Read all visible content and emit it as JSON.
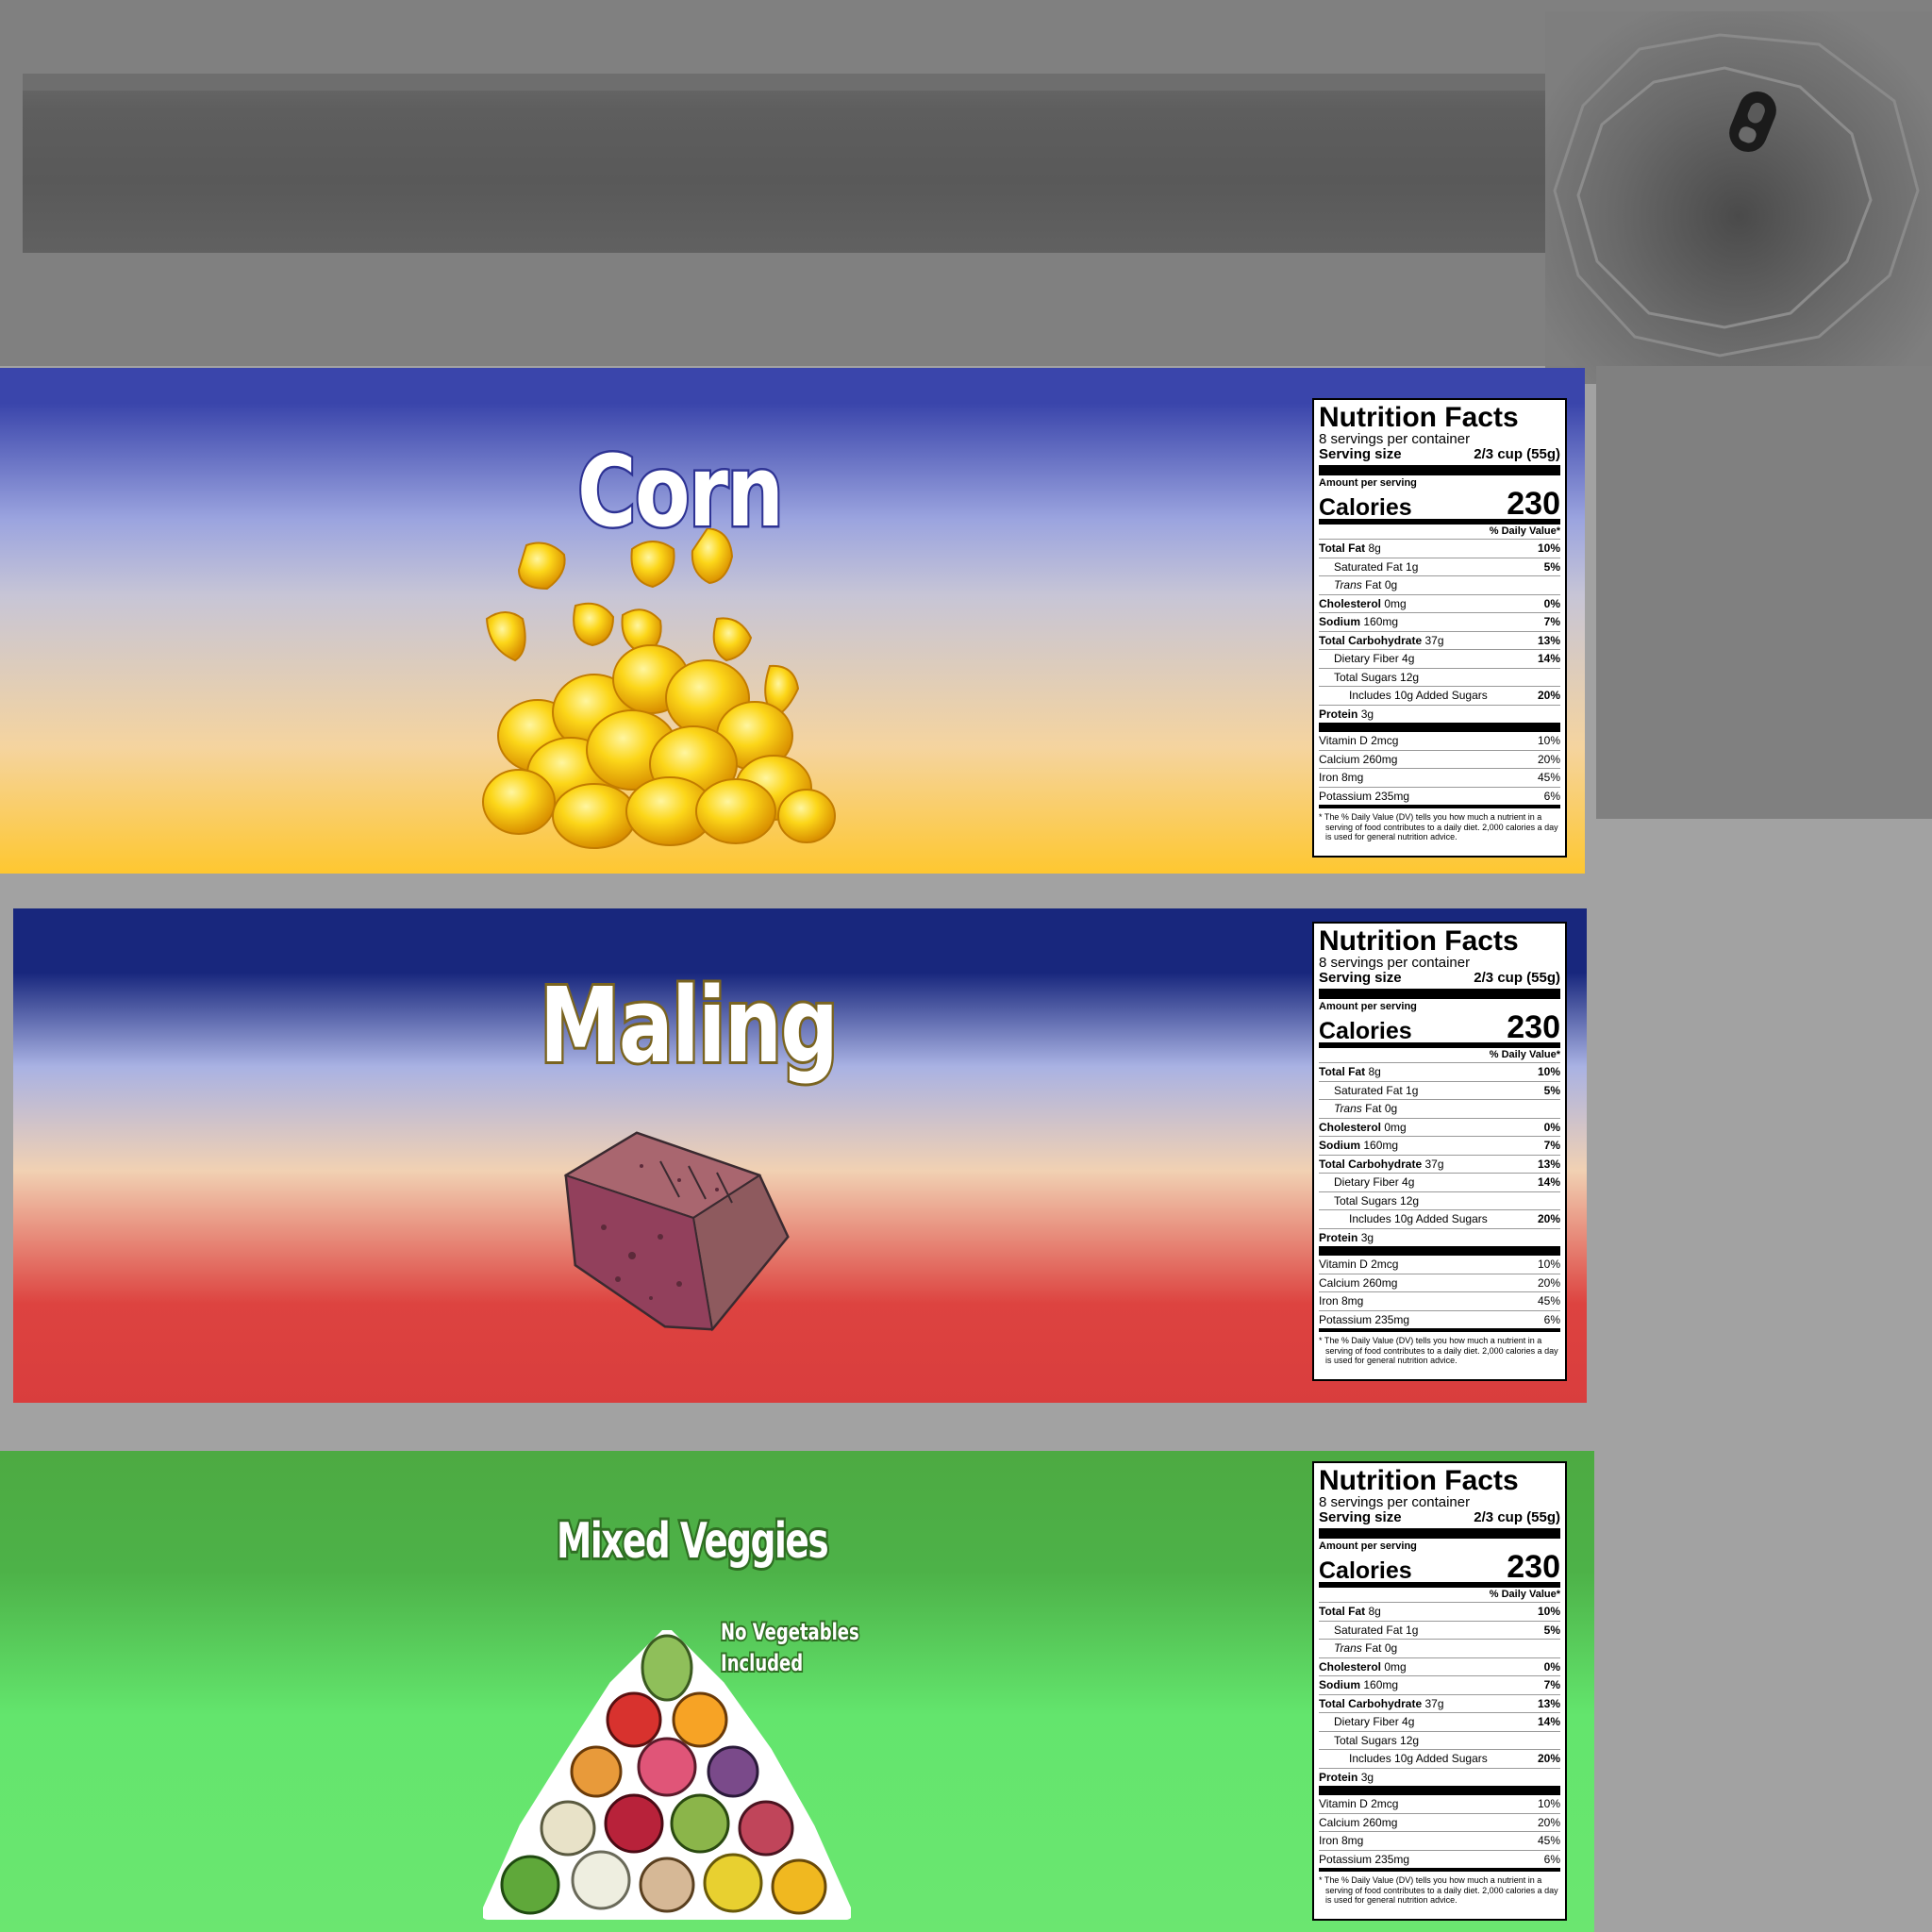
{
  "labels": [
    {
      "id": "corn",
      "title": "Corn"
    },
    {
      "id": "maling",
      "title": "Maling"
    },
    {
      "id": "veggies",
      "title": "Mixed Veggies",
      "note_line1": "No Vegetables",
      "note_line2": "Included"
    }
  ],
  "nutrition": {
    "title": "Nutrition Facts",
    "servings": "8 servings per container",
    "serving_size_label": "Serving size",
    "serving_size_value": "2/3 cup (55g)",
    "amount_per_serving": "Amount per serving",
    "calories_label": "Calories",
    "calories_value": "230",
    "daily_value_header": "% Daily Value*",
    "total_fat_label": "Total Fat",
    "total_fat_amount": "8g",
    "total_fat_pct": "10%",
    "sat_fat": "Saturated Fat 1g",
    "sat_fat_pct": "5%",
    "trans_fat_label": "Trans",
    "trans_fat_rest": "Fat 0g",
    "cholesterol_label": "Cholesterol",
    "cholesterol_amount": "0mg",
    "cholesterol_pct": "0%",
    "sodium_label": "Sodium",
    "sodium_amount": "160mg",
    "sodium_pct": "7%",
    "carb_label": "Total Carbohydrate",
    "carb_amount": "37g",
    "carb_pct": "13%",
    "fiber": "Dietary Fiber 4g",
    "fiber_pct": "14%",
    "sugars": "Total Sugars 12g",
    "added_sugars": "Includes 10g Added Sugars",
    "added_sugars_pct": "20%",
    "protein_label": "Protein",
    "protein_amount": "3g",
    "vitamin_d": "Vitamin D 2mcg",
    "vitamin_d_pct": "10%",
    "calcium": "Calcium 260mg",
    "calcium_pct": "20%",
    "iron": "Iron 8mg",
    "iron_pct": "45%",
    "potassium": "Potassium 235mg",
    "potassium_pct": "6%",
    "footnote": "* The % Daily Value (DV) tells you how much a nutrient in a serving of food contributes to a daily diet. 2,000 calories a day is used for general nutrition advice."
  },
  "icons": [
    "can-side-texture",
    "can-lid-icon",
    "pull-tab-icon",
    "corn-kernels-illustration",
    "spam-block-illustration",
    "vegetable-pyramid-illustration"
  ]
}
